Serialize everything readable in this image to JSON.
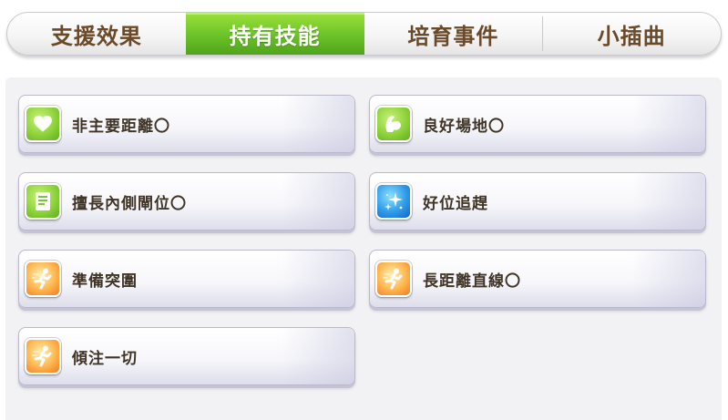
{
  "tabs": [
    {
      "label": "支援效果",
      "active": false
    },
    {
      "label": "持有技能",
      "active": true
    },
    {
      "label": "培育事件",
      "active": false
    },
    {
      "label": "小插曲",
      "active": false
    }
  ],
  "skills": [
    {
      "name": "非主要距離〇",
      "icon": "heart-icon",
      "color": "green"
    },
    {
      "name": "良好場地〇",
      "icon": "flexed-arm-icon",
      "color": "green"
    },
    {
      "name": "擅長內側閘位〇",
      "icon": "book-icon",
      "color": "green"
    },
    {
      "name": "好位追趕",
      "icon": "sparkle-icon",
      "color": "blue"
    },
    {
      "name": "準備突圍",
      "icon": "running-figure-icon",
      "color": "orange"
    },
    {
      "name": "長距離直線〇",
      "icon": "running-figure-icon",
      "color": "orange"
    },
    {
      "name": "傾注一切",
      "icon": "running-figure-icon",
      "color": "orange"
    }
  ],
  "colors": {
    "tab_active": "#6fc52a",
    "tab_text": "#6b4a2a",
    "skill_text": "#3f3426",
    "icon_green": "#8fd33c",
    "icon_orange": "#ffbb55",
    "icon_blue": "#2f9be8"
  }
}
